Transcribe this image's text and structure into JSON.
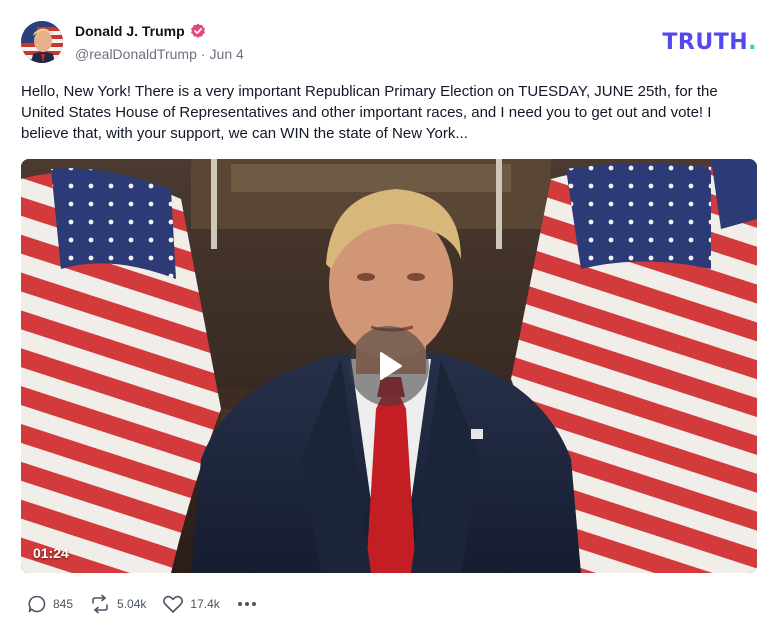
{
  "author": {
    "name": "Donald J. Trump",
    "handle": "@realDonaldTrump",
    "separator": "·",
    "date": "Jun 4",
    "verified": true
  },
  "brand": {
    "logo_text": "TRUTH",
    "logo_dot": ".",
    "logo_color": "#5448ee",
    "logo_dot_color": "#2bd5b8"
  },
  "post": {
    "text": "Hello, New York! There is a very important Republican Primary Election on TUESDAY, JUNE 25th, for the United States House of Representatives and other important races, and I need you to get out and vote! I believe that, with your support, we can WIN the state of New York..."
  },
  "video": {
    "duration": "01:24",
    "play_icon": "play-icon"
  },
  "actions": {
    "replies": "845",
    "retruths": "5.04k",
    "likes": "17.4k",
    "more_icon": "more-icon"
  }
}
